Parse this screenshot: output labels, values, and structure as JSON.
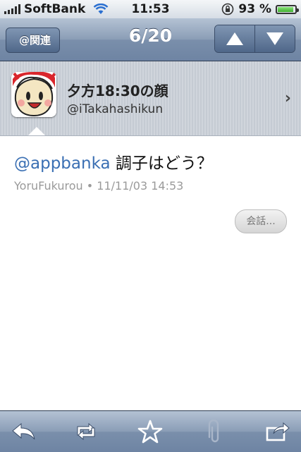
{
  "status": {
    "carrier": "SoftBank",
    "time": "11:53",
    "battery": "93 %",
    "battery_level": 0.93
  },
  "nav": {
    "back_label": "@関連",
    "title": "6/20"
  },
  "user": {
    "name": "夕方18:30の顔",
    "handle": "@iTakahashikun"
  },
  "tweet": {
    "mention": "@appbanka",
    "text": " 調子はどう？",
    "meta": "YoruFukurou • 11/11/03 14:53"
  },
  "conversation_label": "会話...",
  "icons": {
    "reply": "reply-icon",
    "retweet": "retweet-icon",
    "favorite": "star-icon",
    "attach": "paperclip-icon",
    "share": "share-icon"
  }
}
